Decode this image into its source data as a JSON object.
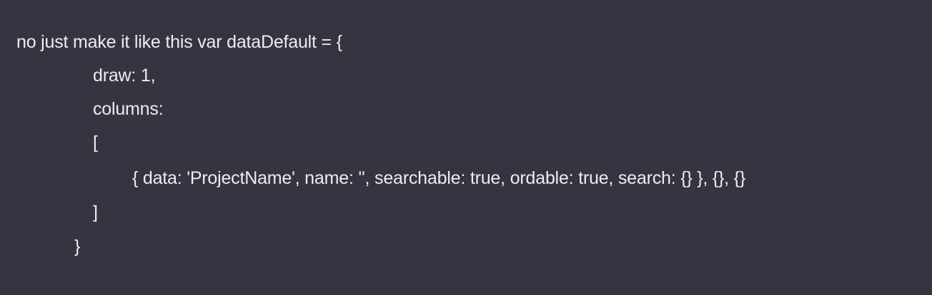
{
  "message": {
    "lines": [
      "no just make it like this var dataDefault = {",
      "draw: 1,",
      "columns:",
      "[",
      "{ data: 'ProjectName', name: '', searchable: true, ordable: true, search: {} }, {}, {}",
      "]",
      "}"
    ]
  },
  "colors": {
    "background": "#343541",
    "text": "#ececf1"
  }
}
